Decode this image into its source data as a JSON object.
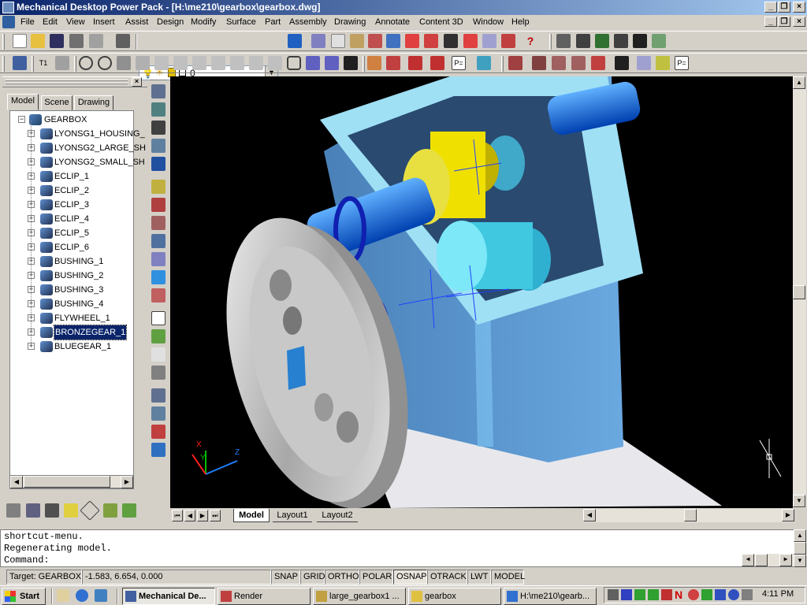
{
  "window": {
    "title": "Mechanical Desktop Power Pack - [H:\\me210\\gearbox\\gearbox.dwg]",
    "minimize": "_",
    "restore": "❐",
    "close": "×"
  },
  "menubar": {
    "items": [
      "File",
      "Edit",
      "View",
      "Insert",
      "Assist",
      "Design",
      "Modify",
      "Surface",
      "Part",
      "Assembly",
      "Drawing",
      "Annotate",
      "Content 3D",
      "Window",
      "Help"
    ]
  },
  "layer": {
    "current": "0"
  },
  "browser": {
    "tabs": [
      "Model",
      "Scene",
      "Drawing"
    ],
    "active_tab": "Model",
    "root": "GEARBOX",
    "nodes": [
      "LYONSG1_HOUSING_",
      "LYONSG2_LARGE_SH",
      "LYONSG2_SMALL_SH",
      "ECLIP_1",
      "ECLIP_2",
      "ECLIP_3",
      "ECLIP_4",
      "ECLIP_5",
      "ECLIP_6",
      "BUSHING_1",
      "BUSHING_2",
      "BUSHING_3",
      "BUSHING_4",
      "FLYWHEEL_1",
      "BRONZEGEAR_1",
      "BLUEGEAR_1"
    ],
    "selected": "BRONZEGEAR_1"
  },
  "viewport": {
    "ucs": {
      "x": "X",
      "y": "Y",
      "z": "Z"
    }
  },
  "layouts": {
    "tabs": [
      "Model",
      "Layout1",
      "Layout2"
    ],
    "active": "Model"
  },
  "command": {
    "lines": [
      "shortcut-menu.",
      "Regenerating model."
    ],
    "prompt": "Command:"
  },
  "status": {
    "target": "Target: GEARBOX",
    "coords": "-1.583, 6.654, 0.000",
    "toggles": [
      "SNAP",
      "GRID",
      "ORTHO",
      "POLAR",
      "OSNAP",
      "OTRACK",
      "LWT",
      "MODEL"
    ]
  },
  "taskbar": {
    "start": "Start",
    "tasks": [
      "Mechanical De...",
      "Render",
      "large_gearbox1 ...",
      "gearbox",
      "H:\\me210\\gearb..."
    ],
    "clock": "4:11 PM"
  },
  "colors": {
    "titlebar": "#0a246a",
    "housing": "#5b9bd5",
    "housing_light": "#9fe0f5",
    "bronze_gear": "#f0e000",
    "blue_gear": "#40c8e0",
    "shaft": "#1a70e0",
    "flywheel": "#b8b8b8"
  }
}
